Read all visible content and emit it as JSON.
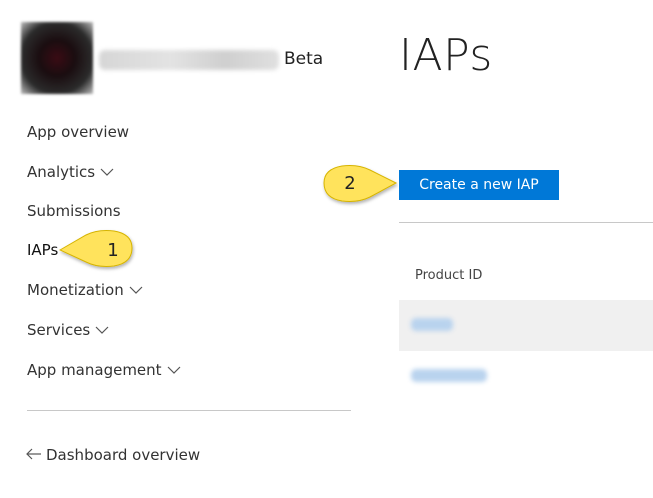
{
  "app": {
    "badge": "Beta"
  },
  "nav": {
    "items": [
      {
        "label": "App overview",
        "expandable": false
      },
      {
        "label": "Analytics",
        "expandable": true
      },
      {
        "label": "Submissions",
        "expandable": false
      },
      {
        "label": "IAPs",
        "expandable": false
      },
      {
        "label": "Monetization",
        "expandable": true
      },
      {
        "label": "Services",
        "expandable": true
      },
      {
        "label": "App management",
        "expandable": true
      }
    ],
    "back_link": "Dashboard overview"
  },
  "main": {
    "title": "IAPs",
    "create_button": "Create a new IAP",
    "table": {
      "column_header": "Product ID"
    }
  },
  "callouts": [
    {
      "number": "1"
    },
    {
      "number": "2"
    }
  ],
  "colors": {
    "accent": "#0078d7",
    "callout_fill": "#ffe35c",
    "row_alt": "#f0f0f0"
  }
}
